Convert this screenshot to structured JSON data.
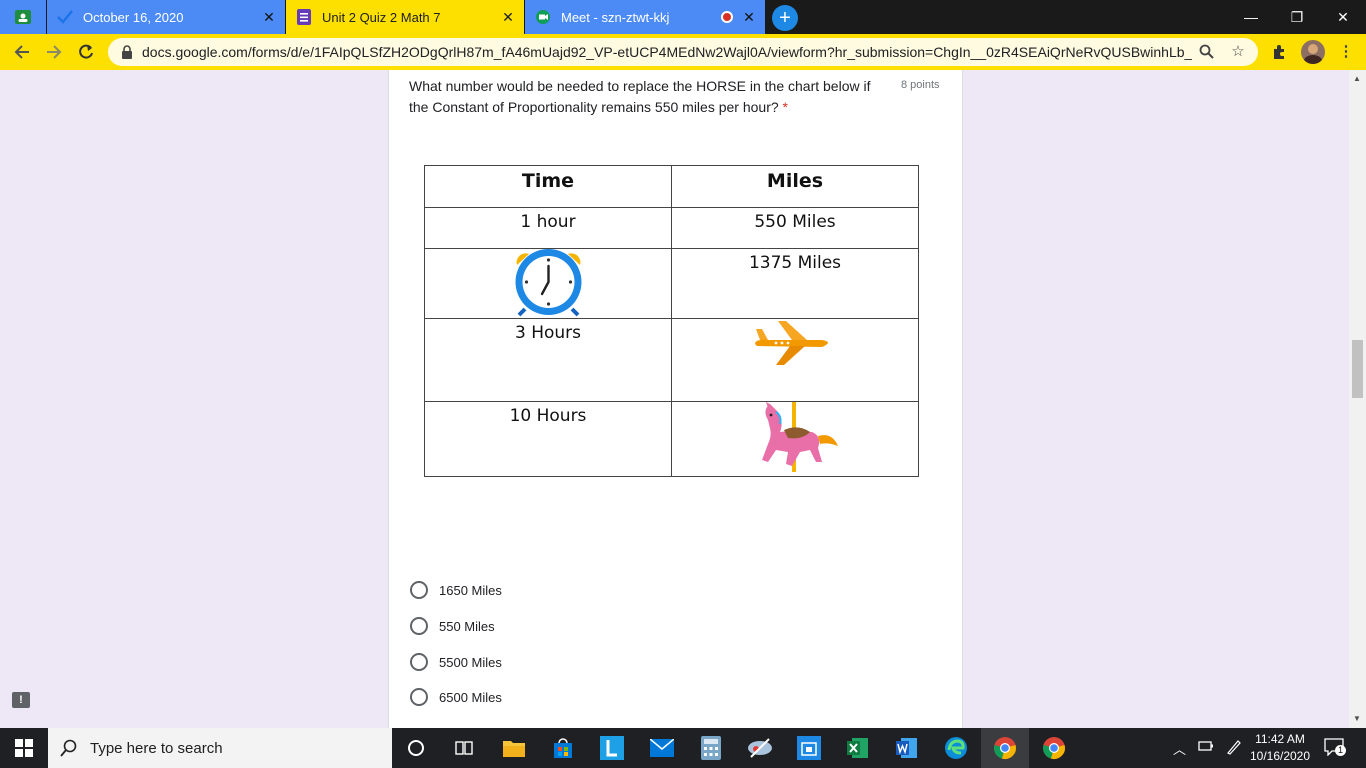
{
  "tabs": [
    {
      "title": "October 16, 2020",
      "active": false,
      "favicon": "checkmark-icon"
    },
    {
      "title": "Unit 2 Quiz 2 Math 7",
      "active": true,
      "favicon": "forms-icon"
    },
    {
      "title": "Meet - szn-ztwt-kkj",
      "active": false,
      "favicon": "meet-icon"
    }
  ],
  "toolbar": {
    "url": "docs.google.com/forms/d/e/1FAIpQLSfZH2ODgQrlH87m_fA46mUajd92_VP-etUCP4MEdNw2Wajl0A/viewform?hr_submission=ChgIn__0zR4SEAiQrNeRvQUSBwinhLb_p..."
  },
  "question": {
    "text": "What number would be needed to replace the HORSE in the chart below if the Constant of Proportionality remains 550 miles per hour?",
    "required_mark": "*",
    "points": "8 points"
  },
  "table": {
    "headers": [
      "Time",
      "Miles"
    ],
    "rows": [
      {
        "time": "1 hour",
        "miles": "550 Miles"
      },
      {
        "time_icon": "alarm-clock-icon",
        "miles": "1375 Miles"
      },
      {
        "time": "3 Hours",
        "miles_icon": "airplane-icon"
      },
      {
        "time": "10 Hours",
        "miles_icon": "carousel-horse-icon"
      }
    ]
  },
  "options": [
    "1650 Miles",
    "550 Miles",
    "5500 Miles",
    "6500 Miles"
  ],
  "taskbar": {
    "search_placeholder": "Type here to search",
    "time": "11:42 AM",
    "date": "10/16/2020",
    "notification_count": "1"
  },
  "colors": {
    "forms_accent": "#673ab7",
    "page_bg": "#ede7f6",
    "chrome_yellow": "#fde000",
    "tab_blue": "#4c8bf5"
  }
}
